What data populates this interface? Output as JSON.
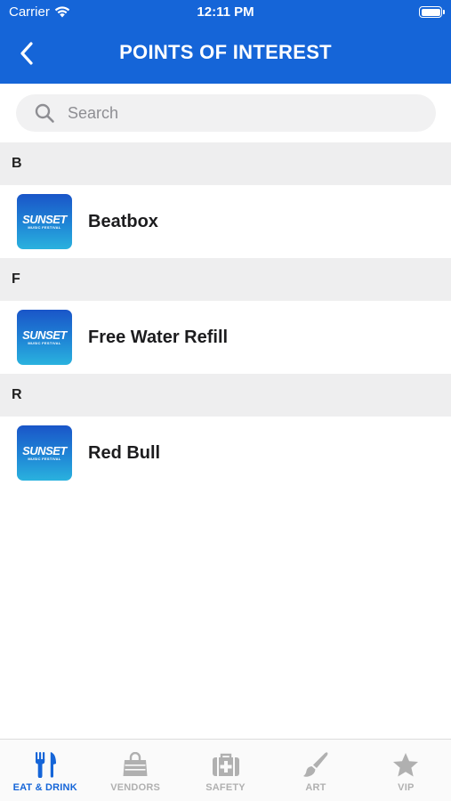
{
  "status_bar": {
    "carrier": "Carrier",
    "time": "12:11 PM"
  },
  "nav": {
    "title": "POINTS OF INTEREST",
    "back_icon": "chevron-left-icon"
  },
  "search": {
    "placeholder": "Search",
    "value": ""
  },
  "sections": [
    {
      "letter": "B",
      "items": [
        {
          "name": "Beatbox",
          "thumb_title": "SUNSET",
          "thumb_subtitle": "MUSIC FESTIVAL"
        }
      ]
    },
    {
      "letter": "F",
      "items": [
        {
          "name": "Free Water Refill",
          "thumb_title": "SUNSET",
          "thumb_subtitle": "MUSIC FESTIVAL"
        }
      ]
    },
    {
      "letter": "R",
      "items": [
        {
          "name": "Red Bull",
          "thumb_title": "SUNSET",
          "thumb_subtitle": "MUSIC FESTIVAL"
        }
      ]
    }
  ],
  "tabs": [
    {
      "label": "EAT & DRINK",
      "icon": "fork-knife-icon",
      "active": true
    },
    {
      "label": "VENDORS",
      "icon": "shopping-bag-icon",
      "active": false
    },
    {
      "label": "SAFETY",
      "icon": "first-aid-icon",
      "active": false
    },
    {
      "label": "ART",
      "icon": "paintbrush-icon",
      "active": false
    },
    {
      "label": "VIP",
      "icon": "star-icon",
      "active": false
    }
  ],
  "colors": {
    "brand_blue": "#1565d8",
    "section_bg": "#eeeeef",
    "inactive_tab": "#b0b0b0"
  }
}
